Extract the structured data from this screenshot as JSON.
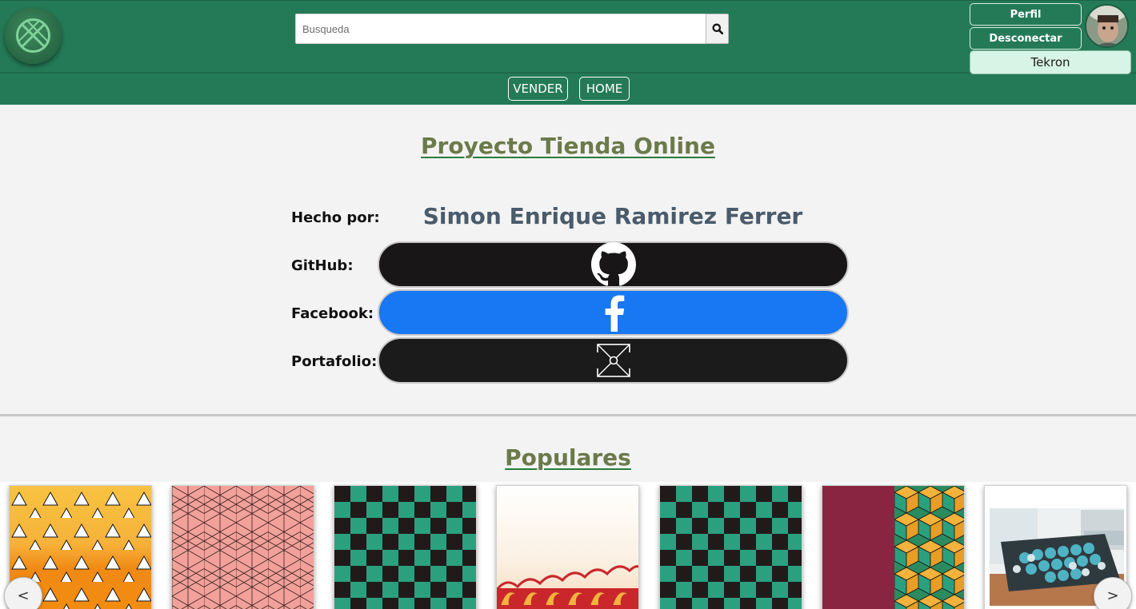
{
  "header": {
    "search_placeholder": "Busqueda",
    "profile_label": "Perfil",
    "logout_label": "Desconectar",
    "username": "Tekron"
  },
  "nav": {
    "items": [
      {
        "label": "VENDER"
      },
      {
        "label": "HOME"
      }
    ]
  },
  "about": {
    "title": "Proyecto Tienda Online",
    "made_by_label": "Hecho por:",
    "author": "Simon Enrique Ramirez Ferrer",
    "github_label": "GitHub:",
    "facebook_label": "Facebook:",
    "portfolio_label": "Portafolio:"
  },
  "popular": {
    "title": "Populares",
    "prev_label": "<",
    "next_label": ">"
  },
  "colors": {
    "brand_green": "#247a57",
    "github": "#181617",
    "facebook": "#1877f2",
    "title_olive": "#6b7a4a"
  }
}
